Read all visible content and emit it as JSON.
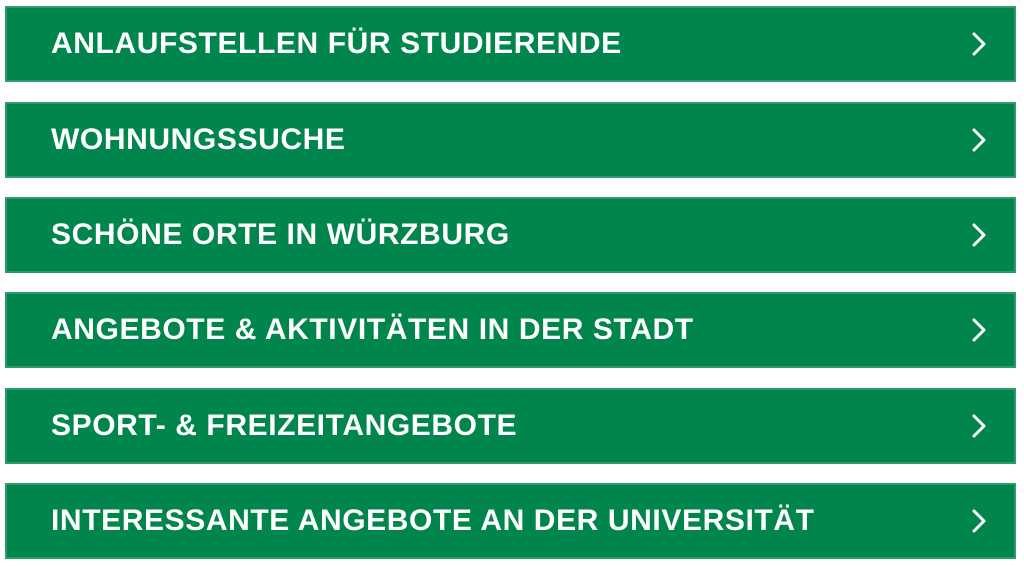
{
  "colors": {
    "accent": "#00864d",
    "text": "#ffffff"
  },
  "menu": {
    "items": [
      {
        "label": "ANLAUFSTELLEN FÜR STUDIERENDE",
        "icon": "chevron-right-icon"
      },
      {
        "label": "WOHNUNGSSUCHE",
        "icon": "chevron-right-icon"
      },
      {
        "label": "SCHÖNE ORTE IN WÜRZBURG",
        "icon": "chevron-right-icon"
      },
      {
        "label": "ANGEBOTE & AKTIVITÄTEN IN DER STADT",
        "icon": "chevron-right-icon"
      },
      {
        "label": "SPORT- & FREIZEITANGEBOTE",
        "icon": "chevron-right-icon"
      },
      {
        "label": "INTERESSANTE ANGEBOTE AN DER UNIVERSITÄT",
        "icon": "chevron-right-icon"
      }
    ]
  }
}
